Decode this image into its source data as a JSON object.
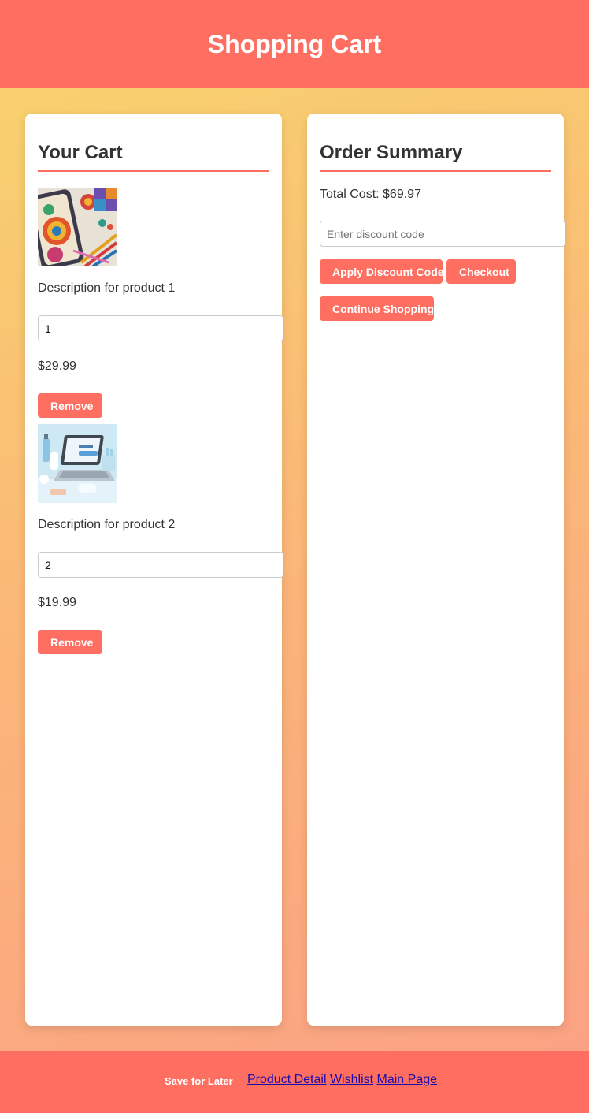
{
  "header": {
    "title": "Shopping Cart"
  },
  "cart": {
    "title": "Your Cart",
    "items": [
      {
        "description": "Description for product 1",
        "quantity": "1",
        "price": "$29.99",
        "remove_label": "Remove"
      },
      {
        "description": "Description for product 2",
        "quantity": "2",
        "price": "$19.99",
        "remove_label": "Remove"
      }
    ]
  },
  "summary": {
    "title": "Order Summary",
    "total": "Total Cost: $69.97",
    "discount_placeholder": "Enter discount code",
    "apply_label": "Apply Discount Code",
    "checkout_label": "Checkout",
    "continue_label": "Continue Shopping"
  },
  "footer": {
    "save_label": "Save for Later",
    "links": [
      "Product Detail",
      "Wishlist",
      "Main Page"
    ]
  },
  "colors": {
    "accent": "#ff6f61",
    "link": "#1a0dab"
  }
}
